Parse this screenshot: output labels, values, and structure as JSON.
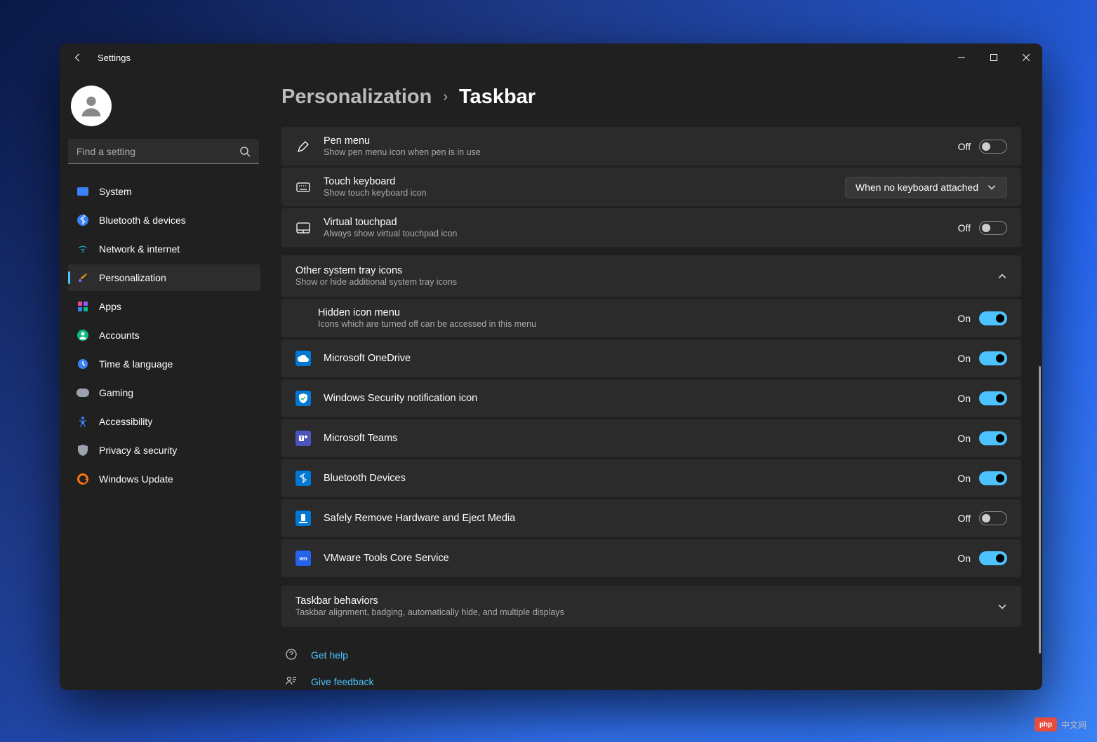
{
  "window": {
    "title": "Settings"
  },
  "breadcrumb": {
    "parent": "Personalization",
    "current": "Taskbar"
  },
  "search": {
    "placeholder": "Find a setting"
  },
  "sidebar": {
    "items": [
      {
        "label": "System",
        "icon": "system",
        "color": "#3b82f6"
      },
      {
        "label": "Bluetooth & devices",
        "icon": "bluetooth",
        "color": "#3b82f6"
      },
      {
        "label": "Network & internet",
        "icon": "wifi",
        "color": "#06b6d4"
      },
      {
        "label": "Personalization",
        "icon": "brush",
        "color": "#f59e0b",
        "active": true
      },
      {
        "label": "Apps",
        "icon": "apps",
        "color": "#ec4899"
      },
      {
        "label": "Accounts",
        "icon": "person",
        "color": "#10b981"
      },
      {
        "label": "Time & language",
        "icon": "clock",
        "color": "#3b82f6"
      },
      {
        "label": "Gaming",
        "icon": "gamepad",
        "color": "#9ca3af"
      },
      {
        "label": "Accessibility",
        "icon": "accessibility",
        "color": "#3b82f6"
      },
      {
        "label": "Privacy & security",
        "icon": "shield",
        "color": "#9ca3af"
      },
      {
        "label": "Windows Update",
        "icon": "update",
        "color": "#f97316"
      }
    ]
  },
  "settings": {
    "pen_menu": {
      "title": "Pen menu",
      "desc": "Show pen menu icon when pen is in use",
      "state": "Off",
      "on": false
    },
    "touch_keyboard": {
      "title": "Touch keyboard",
      "desc": "Show touch keyboard icon",
      "dropdown": "When no keyboard attached"
    },
    "virtual_touchpad": {
      "title": "Virtual touchpad",
      "desc": "Always show virtual touchpad icon",
      "state": "Off",
      "on": false
    }
  },
  "section_other_tray": {
    "title": "Other system tray icons",
    "desc": "Show or hide additional system tray icons",
    "expanded": true
  },
  "tray_items": {
    "hidden_menu": {
      "title": "Hidden icon menu",
      "desc": "Icons which are turned off can be accessed in this menu",
      "state": "On",
      "on": true
    },
    "onedrive": {
      "title": "Microsoft OneDrive",
      "state": "On",
      "on": true,
      "color": "#0078d4"
    },
    "security": {
      "title": "Windows Security notification icon",
      "state": "On",
      "on": true,
      "color": "#0078d4"
    },
    "teams": {
      "title": "Microsoft Teams",
      "state": "On",
      "on": true,
      "color": "#4b53bc"
    },
    "bluetooth": {
      "title": "Bluetooth Devices",
      "state": "On",
      "on": true,
      "color": "#0078d4"
    },
    "eject": {
      "title": "Safely Remove Hardware and Eject Media",
      "state": "Off",
      "on": false,
      "color": "#0078d4"
    },
    "vmware": {
      "title": "VMware Tools Core Service",
      "state": "On",
      "on": true,
      "color": "#2563eb"
    }
  },
  "section_behaviors": {
    "title": "Taskbar behaviors",
    "desc": "Taskbar alignment, badging, automatically hide, and multiple displays",
    "expanded": false
  },
  "help": {
    "get_help": "Get help",
    "feedback": "Give feedback"
  },
  "toggle_labels": {
    "on": "On",
    "off": "Off"
  },
  "watermark": {
    "text": "中文网",
    "logo": "php"
  }
}
